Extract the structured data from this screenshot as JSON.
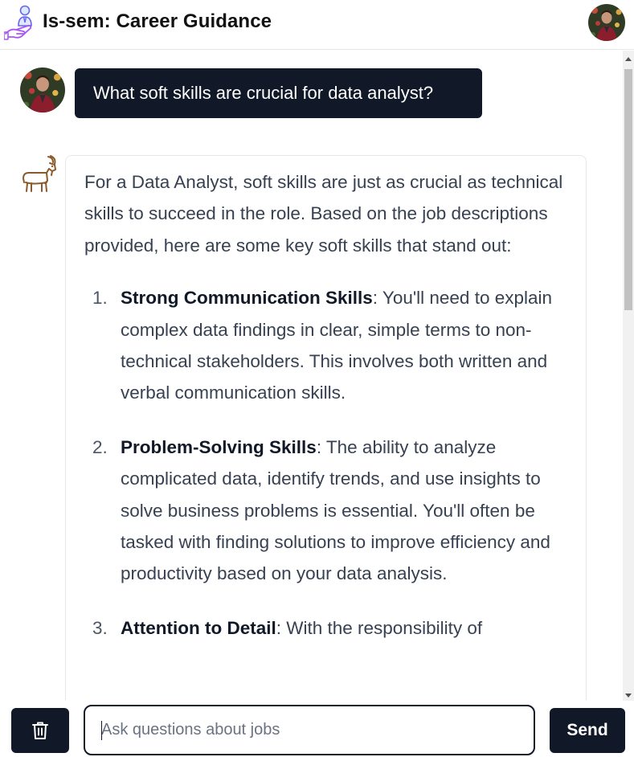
{
  "app": {
    "title": "Is-sem: Career Guidance"
  },
  "conversation": {
    "user_message": "What soft skills are crucial for data analyst?",
    "bot_intro": "For a Data Analyst, soft skills are just as crucial as technical skills to succeed in the role. Based on the job descriptions provided, here are some key soft skills that stand out:",
    "skills": [
      {
        "number": "1.",
        "title": "Strong Communication Skills",
        "text": ": You'll need to explain complex data findings in clear, simple terms to non-technical stakeholders. This involves both written and verbal communication skills."
      },
      {
        "number": "2.",
        "title": "Problem-Solving Skills",
        "text": ": The ability to analyze complicated data, identify trends, and use insights to solve business problems is essential. You'll often be tasked with finding solutions to improve efficiency and productivity based on your data analysis."
      },
      {
        "number": "3.",
        "title": "Attention to Detail",
        "text": ": With the responsibility of"
      }
    ]
  },
  "composer": {
    "placeholder": "Ask questions about jobs",
    "value": "",
    "send_label": "Send"
  },
  "icons": {
    "logo": "career-advisor-hand-icon",
    "bot": "goat-icon",
    "clear": "trash-icon"
  },
  "colors": {
    "primary": "#111827",
    "text": "#374151",
    "border": "#e5e7eb"
  }
}
